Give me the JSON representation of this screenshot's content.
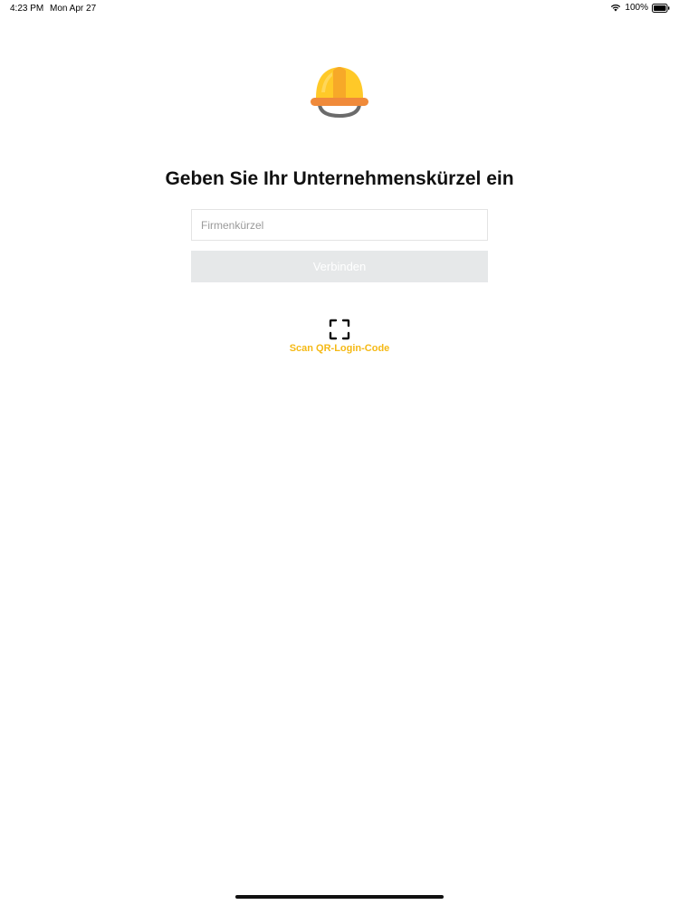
{
  "status_bar": {
    "time": "4:23 PM",
    "date": "Mon Apr 27",
    "battery": "100%",
    "wifi_icon": "wifi-icon",
    "battery_icon": "battery-icon"
  },
  "logo": {
    "icon": "hard-hat-icon",
    "colors": {
      "primary": "#ffc928",
      "secondary": "#f7a928",
      "band": "#f08a3a",
      "strap": "#6b6b6b"
    }
  },
  "login": {
    "title": "Geben Sie Ihr Unternehmenskürzel ein",
    "company_input": {
      "placeholder": "Firmenkürzel",
      "value": ""
    },
    "connect_label": "Verbinden",
    "connect_enabled": false
  },
  "qr": {
    "icon": "scan-frame-icon",
    "label": "Scan QR-Login-Code",
    "accent_color": "#f5b915"
  }
}
